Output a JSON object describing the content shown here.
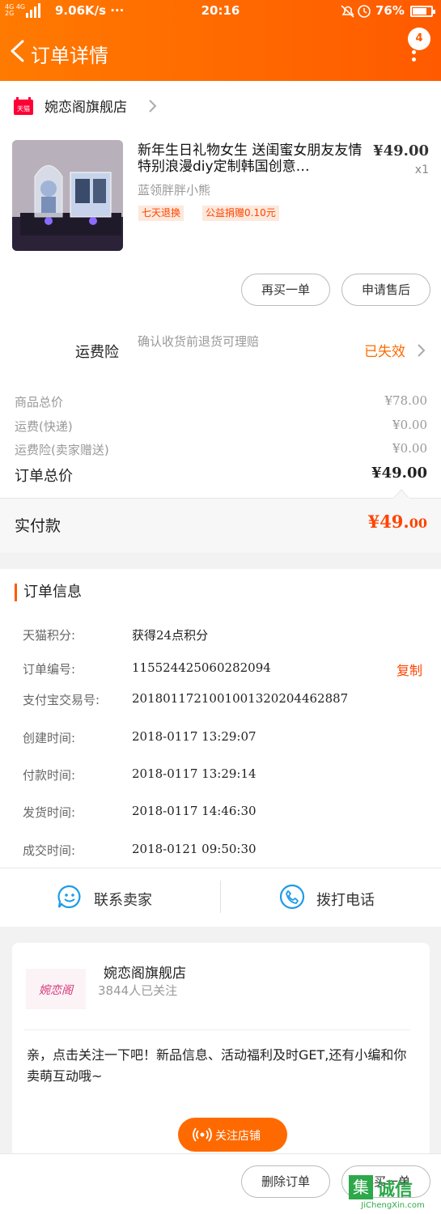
{
  "status_bar": {
    "network_small": "4G 4G",
    "network_small2": "2G",
    "speed": "9.06K/s",
    "dots": "···",
    "time": "20:16",
    "battery": "76%"
  },
  "nav": {
    "title": "订单详情",
    "badge": "4"
  },
  "store": {
    "badge": "天猫",
    "name": "婉恋阁旗舰店"
  },
  "product": {
    "title": "新年生日礼物女生 送闺蜜女朋友友情特别浪漫diy定制韩国创意…",
    "price": "¥49.00",
    "qty": "x1",
    "sku": "蓝领胖胖小熊",
    "tags": [
      "七天退换",
      "公益捐赠0.10元"
    ]
  },
  "actions": {
    "buy_again": "再买一单",
    "after_sale": "申请售后"
  },
  "insurance": {
    "label": "运费险",
    "desc": "确认收货前退货可理赔",
    "status": "已失效"
  },
  "summary": [
    {
      "label": "商品总价",
      "value": "¥78.00"
    },
    {
      "label": "运费(快递)",
      "value": "¥0.00"
    },
    {
      "label": "运费险(卖家赠送)",
      "value": "¥0.00"
    },
    {
      "label": "订单总价",
      "value": "¥49.00"
    }
  ],
  "paid": {
    "label": "实付款",
    "value_main": "¥49.",
    "value_cents": "00"
  },
  "order_info": {
    "title": "订单信息",
    "copy": "复制",
    "rows": [
      {
        "k": "天猫积分:",
        "v": "获得24点积分"
      },
      {
        "k": "订单编号:",
        "v": "115524425060282094"
      },
      {
        "k": "支付宝交易号:",
        "v": "2018011721001001320204462887"
      },
      {
        "k": "创建时间:",
        "v": "2018-0117 13:29:07"
      },
      {
        "k": "付款时间:",
        "v": "2018-0117 13:29:14"
      },
      {
        "k": "发货时间:",
        "v": "2018-0117 14:46:30"
      },
      {
        "k": "成交时间:",
        "v": "2018-0121 09:50:30"
      }
    ]
  },
  "contact": {
    "seller": "联系卖家",
    "call": "拨打电话"
  },
  "shop_card": {
    "logo_text": "婉恋阁",
    "name": "婉恋阁旗舰店",
    "followers": "3844人已关注",
    "message": "亲，点击关注一下吧！新品信息、活动福利及时GET,还有小编和你卖萌互动哦~",
    "follow_button": "关注店铺"
  },
  "footer": {
    "delete": "删除订单",
    "buy_again": "再买一单"
  },
  "watermark": {
    "box": "集",
    "cn": "诚信",
    "url": "JiChengXin.com"
  },
  "colors": {
    "brand_orange": "#ff5a00",
    "price_red": "#ff4400"
  }
}
